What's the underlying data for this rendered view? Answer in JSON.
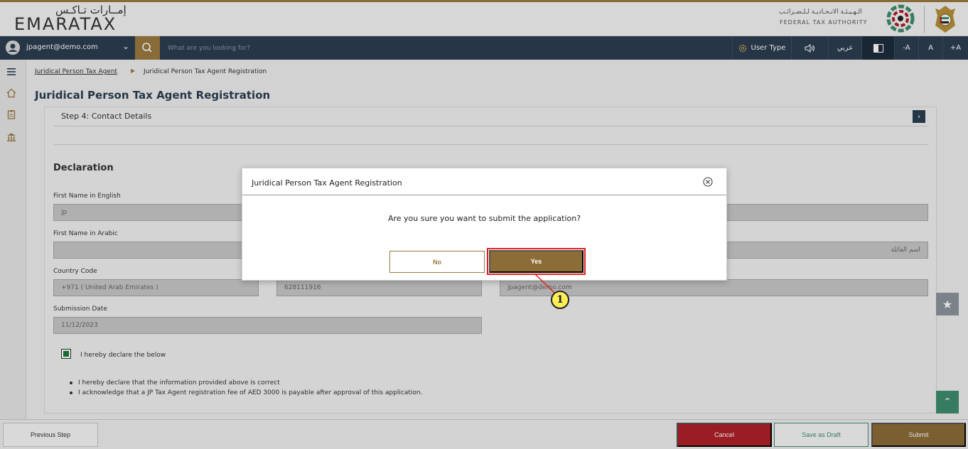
{
  "brand": {
    "logo_arabic": "إمــارات تـاكـس",
    "logo_english": "EMARATAX",
    "authority_arabic": "الـهـيـئـة الاتـحـاديـة لـلـضـرائـب",
    "authority_english": "FEDERAL TAX AUTHORITY"
  },
  "nav": {
    "user_email": "jpagent@demo.com",
    "search_placeholder": "What are you looking for?",
    "user_type_label": "User Type",
    "language_label": "عربي",
    "font_decrease": "-A",
    "font_normal": "A",
    "font_increase": "+A"
  },
  "breadcrumb": {
    "parent": "Juridical Person Tax Agent",
    "current": "Juridical Person Tax Agent Registration"
  },
  "page": {
    "title": "Juridical Person Tax Agent Registration",
    "step_title": "Step 4: Contact Details",
    "section_title": "Declaration"
  },
  "fields": {
    "first_name_en_label": "First Name in English",
    "first_name_en_value": "jp",
    "first_name_ar_label": "First Name in Arabic",
    "first_name_ar_value": "",
    "family_name_ar_value": "اسم العائلة",
    "country_code_label": "Country Code",
    "country_code_value": "+971 ( United Arab Emirates )",
    "phone_value": "628111916",
    "email_value": "jpagent@demo.com",
    "submission_date_label": "Submission Date",
    "submission_date_value": "11/12/2023"
  },
  "declaration": {
    "checkbox_label": "I hereby declare the below",
    "checked": true,
    "bullets": [
      "I hereby declare that the information provided above is correct",
      "I acknowledge that a JP Tax Agent registration fee of AED 3000 is payable after approval of this application."
    ]
  },
  "footer": {
    "previous": "Previous Step",
    "cancel": "Cancel",
    "save_draft": "Save as Draft",
    "submit": "Submit"
  },
  "modal": {
    "title": "Juridical Person Tax Agent Registration",
    "message": "Are you sure you want to submit the application?",
    "no_label": "No",
    "yes_label": "Yes"
  },
  "annotation": {
    "step_number": "1"
  },
  "colors": {
    "gold": "#9b7a3e",
    "navy": "#2c3e50",
    "cancel_red": "#b22028",
    "draft_green": "#3e8e6e",
    "highlight_red": "#e02020"
  }
}
